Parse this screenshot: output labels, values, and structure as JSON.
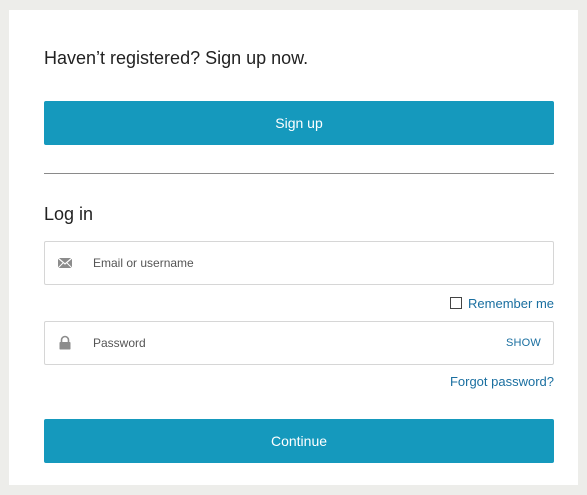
{
  "signup": {
    "heading": "Haven’t registered? Sign up now.",
    "button_label": "Sign up"
  },
  "login": {
    "heading": "Log in",
    "email_placeholder": "Email or username",
    "email_value": "",
    "email_icon": "envelope-icon",
    "remember_label": "Remember me",
    "remember_checked": false,
    "password_placeholder": "Password",
    "password_value": "",
    "password_icon": "lock-icon",
    "show_label": "SHOW",
    "forgot_label": "Forgot password?",
    "continue_label": "Continue"
  },
  "colors": {
    "accent": "#1599bd",
    "link": "#1a6fa0",
    "page_background": "#ededea"
  }
}
